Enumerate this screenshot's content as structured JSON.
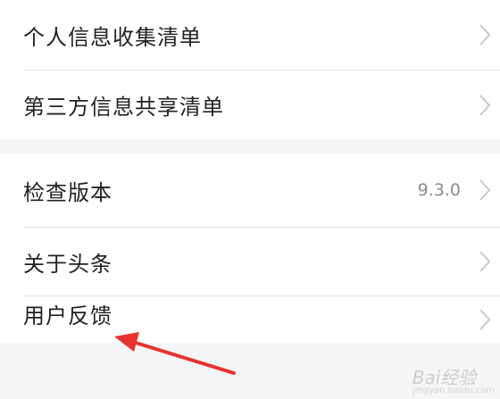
{
  "settings": {
    "group1": [
      {
        "label": "个人信息收集清单"
      },
      {
        "label": "第三方信息共享清单"
      }
    ],
    "group2": [
      {
        "label": "检查版本",
        "value": "9.3.0"
      },
      {
        "label": "关于头条"
      },
      {
        "label": "用户反馈"
      }
    ]
  },
  "annotation": {
    "arrow_color": "#e8322f"
  },
  "watermark": {
    "text": "Bai经验",
    "sub": "jingyan.baidu.com"
  },
  "colors": {
    "background": "#f4f5f6",
    "card": "#ffffff",
    "text": "#222222",
    "chevron": "#c8c8c8"
  }
}
